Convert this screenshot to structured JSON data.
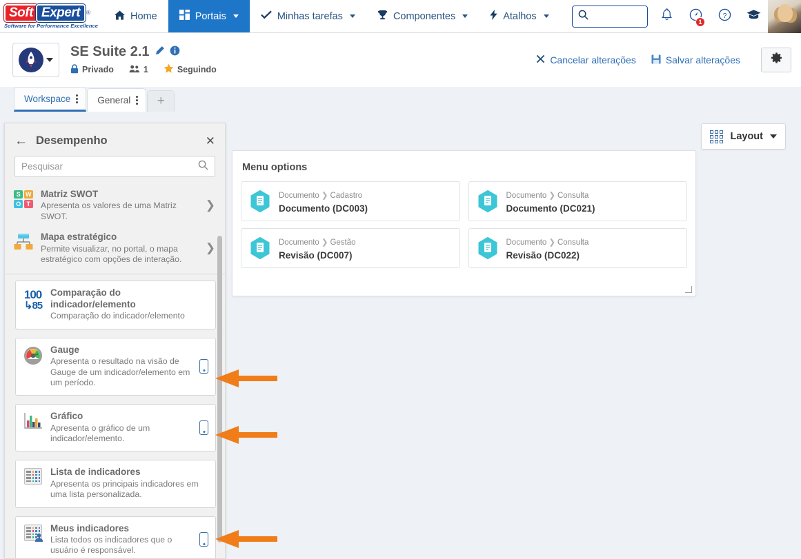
{
  "topnav": {
    "logo": {
      "soft": "Soft",
      "expert": "Expert",
      "reg": "®",
      "tagline": "Software for Performance Excellence"
    },
    "items": [
      {
        "label": "Home",
        "icon": "home-icon",
        "caret": false,
        "active": false
      },
      {
        "label": "Portais",
        "icon": "grid-icon",
        "caret": true,
        "active": true
      },
      {
        "label": "Minhas tarefas",
        "icon": "check-icon",
        "caret": true,
        "active": false
      },
      {
        "label": "Componentes",
        "icon": "trophy-icon",
        "caret": true,
        "active": false
      },
      {
        "label": "Atalhos",
        "icon": "bolt-icon",
        "caret": true,
        "active": false
      }
    ],
    "search": {
      "value": "",
      "placeholder": ""
    },
    "notification_badge": "1"
  },
  "page_header": {
    "title": "SE Suite 2.1",
    "privacy": "Privado",
    "members_count": "1",
    "following": "Seguindo",
    "cancel_label": "Cancelar alterações",
    "save_label": "Salvar alterações"
  },
  "tabs": [
    {
      "label": "Workspace",
      "active": true
    },
    {
      "label": "General",
      "active": false
    }
  ],
  "tab_add_label": "+",
  "side_panel": {
    "title": "Desempenho",
    "search_placeholder": "Pesquisar",
    "search_value": "",
    "plain_items": [
      {
        "title": "Matriz SWOT",
        "desc": "Apresenta os valores de uma Matriz SWOT.",
        "icon": "swot-matrix-icon",
        "swot_letters": [
          "S",
          "W",
          "O",
          "T"
        ],
        "swot_colors": [
          "#3dbb84",
          "#f0a93b",
          "#3ec0e0",
          "#f05b72"
        ]
      },
      {
        "title": "Mapa estratégico",
        "desc": "Permite visualizar, no portal, o mapa estratégico com opções de interação.",
        "icon": "strategic-map-icon"
      }
    ],
    "card_items": [
      {
        "title": "Comparação do indicador/elemento",
        "desc": "Comparação do indicador/elemento",
        "icon": "comparison-number-icon",
        "icon_top": "100",
        "icon_bottom": "85",
        "mobile": false
      },
      {
        "title": "Gauge",
        "desc": "Apresenta o resultado na visão de Gauge de um indicador/elemento em um período.",
        "icon": "gauge-icon",
        "mobile": true
      },
      {
        "title": "Gráfico",
        "desc": "Apresenta o gráfico de um indicador/elemento.",
        "icon": "bar-chart-icon",
        "mobile": true
      },
      {
        "title": "Lista de indicadores",
        "desc": "Apresenta os principais indicadores em uma lista personalizada.",
        "icon": "indicator-list-icon",
        "mobile": false
      },
      {
        "title": "Meus indicadores",
        "desc": "Lista todos os indicadores que o usuário é responsável.",
        "icon": "my-indicators-icon",
        "mobile": true
      }
    ]
  },
  "main": {
    "layout_button": "Layout",
    "menu_panel_title": "Menu options",
    "menu_cards": [
      {
        "crumb_parent": "Documento",
        "crumb_child": "Cadastro",
        "name": "Documento (DC003)",
        "icon": "document-hex-icon"
      },
      {
        "crumb_parent": "Documento",
        "crumb_child": "Consulta",
        "name": "Documento (DC021)",
        "icon": "document-hex-icon"
      },
      {
        "crumb_parent": "Documento",
        "crumb_child": "Gestão",
        "name": "Revisão (DC007)",
        "icon": "document-hex-icon"
      },
      {
        "crumb_parent": "Documento",
        "crumb_child": "Consulta",
        "name": "Revisão (DC022)",
        "icon": "document-hex-icon"
      }
    ]
  },
  "colors": {
    "nav_active": "#1e76c8",
    "link_blue": "#2f6fb5",
    "brand_red": "#e8232a",
    "brand_blue": "#1a4f9c",
    "hex_teal": "#3cc6d6",
    "arrow_orange": "#f07d18",
    "badge_red": "#e02b2b"
  }
}
